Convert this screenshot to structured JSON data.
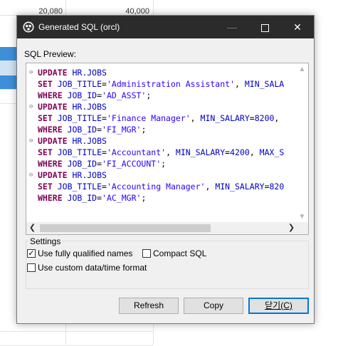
{
  "background": {
    "top_values": [
      "20,080",
      "40,000"
    ]
  },
  "dialog": {
    "title": "Generated SQL (orcl)",
    "sql_preview_label": "SQL Preview:",
    "sql_lines": [
      {
        "fold": true,
        "parts": [
          {
            "t": "kw",
            "v": "UPDATE"
          },
          {
            "t": "plain",
            "v": " "
          },
          {
            "t": "tbl",
            "v": "HR.JOBS"
          }
        ]
      },
      {
        "fold": false,
        "parts": [
          {
            "t": "kw",
            "v": "SET"
          },
          {
            "t": "plain",
            "v": " "
          },
          {
            "t": "col",
            "v": "JOB_TITLE"
          },
          {
            "t": "plain",
            "v": "="
          },
          {
            "t": "str",
            "v": "'Administration Assistant'"
          },
          {
            "t": "plain",
            "v": ", "
          },
          {
            "t": "col",
            "v": "MIN_SALA"
          }
        ]
      },
      {
        "fold": false,
        "parts": [
          {
            "t": "kw",
            "v": "WHERE"
          },
          {
            "t": "plain",
            "v": " "
          },
          {
            "t": "col",
            "v": "JOB_ID"
          },
          {
            "t": "plain",
            "v": "="
          },
          {
            "t": "str",
            "v": "'AD_ASST'"
          },
          {
            "t": "plain",
            "v": ";"
          }
        ]
      },
      {
        "fold": true,
        "parts": [
          {
            "t": "kw",
            "v": "UPDATE"
          },
          {
            "t": "plain",
            "v": " "
          },
          {
            "t": "tbl",
            "v": "HR.JOBS"
          }
        ]
      },
      {
        "fold": false,
        "parts": [
          {
            "t": "kw",
            "v": "SET"
          },
          {
            "t": "plain",
            "v": " "
          },
          {
            "t": "col",
            "v": "JOB_TITLE"
          },
          {
            "t": "plain",
            "v": "="
          },
          {
            "t": "str",
            "v": "'Finance Manager'"
          },
          {
            "t": "plain",
            "v": ", "
          },
          {
            "t": "col",
            "v": "MIN_SALARY"
          },
          {
            "t": "plain",
            "v": "="
          },
          {
            "t": "col",
            "v": "8200"
          },
          {
            "t": "plain",
            "v": ","
          }
        ]
      },
      {
        "fold": false,
        "parts": [
          {
            "t": "kw",
            "v": "WHERE"
          },
          {
            "t": "plain",
            "v": " "
          },
          {
            "t": "col",
            "v": "JOB_ID"
          },
          {
            "t": "plain",
            "v": "="
          },
          {
            "t": "str",
            "v": "'FI_MGR'"
          },
          {
            "t": "plain",
            "v": ";"
          }
        ]
      },
      {
        "fold": true,
        "parts": [
          {
            "t": "kw",
            "v": "UPDATE"
          },
          {
            "t": "plain",
            "v": " "
          },
          {
            "t": "tbl",
            "v": "HR.JOBS"
          }
        ]
      },
      {
        "fold": false,
        "parts": [
          {
            "t": "kw",
            "v": "SET"
          },
          {
            "t": "plain",
            "v": " "
          },
          {
            "t": "col",
            "v": "JOB_TITLE"
          },
          {
            "t": "plain",
            "v": "="
          },
          {
            "t": "str",
            "v": "'Accountant'"
          },
          {
            "t": "plain",
            "v": ", "
          },
          {
            "t": "col",
            "v": "MIN_SALARY"
          },
          {
            "t": "plain",
            "v": "="
          },
          {
            "t": "col",
            "v": "4200"
          },
          {
            "t": "plain",
            "v": ", "
          },
          {
            "t": "col",
            "v": "MAX_S"
          }
        ]
      },
      {
        "fold": false,
        "parts": [
          {
            "t": "kw",
            "v": "WHERE"
          },
          {
            "t": "plain",
            "v": " "
          },
          {
            "t": "col",
            "v": "JOB_ID"
          },
          {
            "t": "plain",
            "v": "="
          },
          {
            "t": "str",
            "v": "'FI_ACCOUNT'"
          },
          {
            "t": "plain",
            "v": ";"
          }
        ]
      },
      {
        "fold": true,
        "parts": [
          {
            "t": "kw",
            "v": "UPDATE"
          },
          {
            "t": "plain",
            "v": " "
          },
          {
            "t": "tbl",
            "v": "HR.JOBS"
          }
        ]
      },
      {
        "fold": false,
        "parts": [
          {
            "t": "kw",
            "v": "SET"
          },
          {
            "t": "plain",
            "v": " "
          },
          {
            "t": "col",
            "v": "JOB_TITLE"
          },
          {
            "t": "plain",
            "v": "="
          },
          {
            "t": "str",
            "v": "'Accounting Manager'"
          },
          {
            "t": "plain",
            "v": ", "
          },
          {
            "t": "col",
            "v": "MIN_SALARY"
          },
          {
            "t": "plain",
            "v": "="
          },
          {
            "t": "col",
            "v": "820"
          }
        ]
      },
      {
        "fold": false,
        "parts": [
          {
            "t": "kw",
            "v": "WHERE"
          },
          {
            "t": "plain",
            "v": " "
          },
          {
            "t": "col",
            "v": "JOB_ID"
          },
          {
            "t": "plain",
            "v": "="
          },
          {
            "t": "str",
            "v": "'AC_MGR'"
          },
          {
            "t": "plain",
            "v": ";"
          }
        ]
      }
    ],
    "settings": {
      "legend": "Settings",
      "fully_qualified": {
        "label": "Use fully qualified names",
        "checked": true
      },
      "compact_sql": {
        "label": "Compact SQL",
        "checked": false
      },
      "custom_format": {
        "label": "Use custom data/time format",
        "checked": false
      }
    },
    "buttons": {
      "refresh": "Refresh",
      "copy": "Copy",
      "close": "닫기(C)"
    }
  },
  "colors": {
    "keyword": "#7f0055",
    "identifier": "#0000c0",
    "string": "#2a00ff",
    "titlebar": "#2b2b2b",
    "default_button_border": "#0078d7"
  }
}
